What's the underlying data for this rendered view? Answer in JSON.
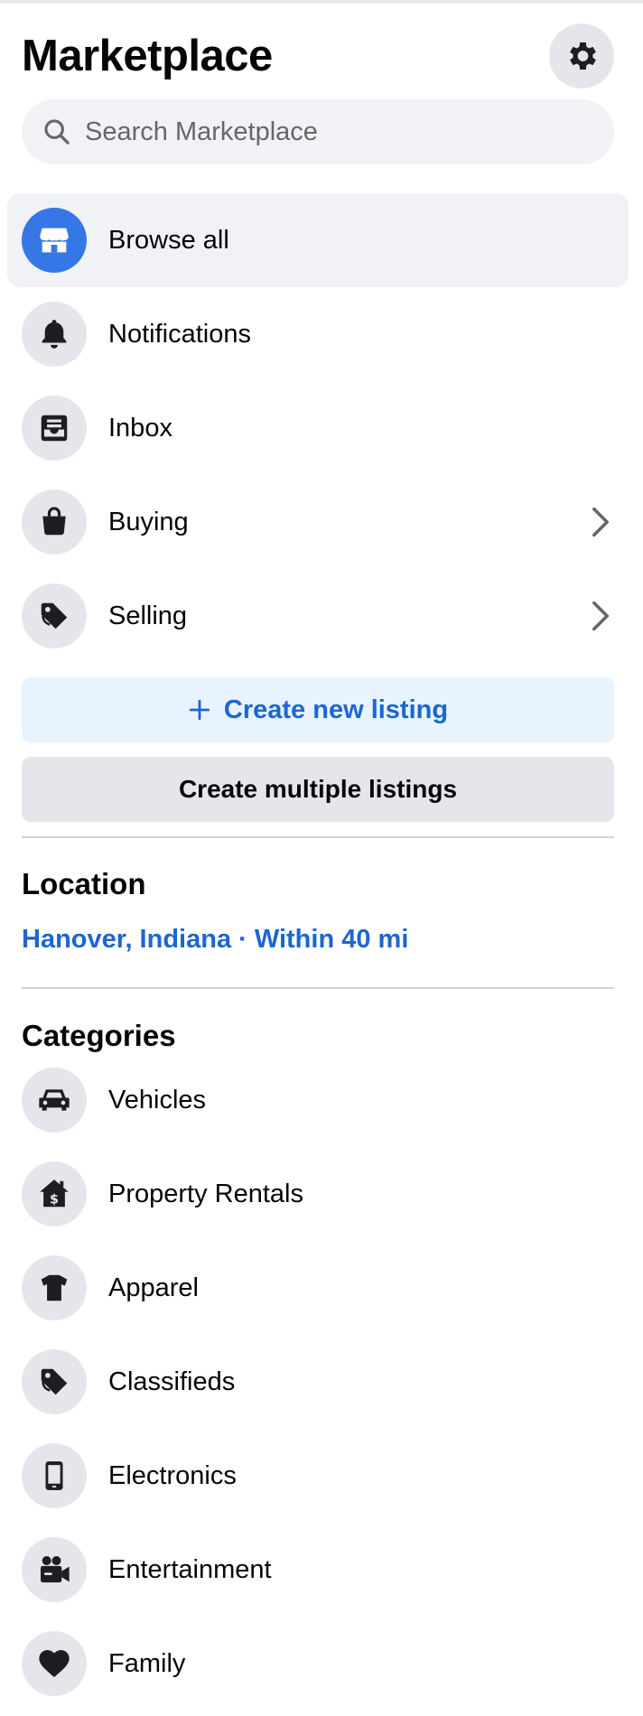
{
  "header": {
    "title": "Marketplace",
    "settings_icon": "gear-icon"
  },
  "search": {
    "placeholder": "Search Marketplace",
    "value": ""
  },
  "nav": {
    "items": [
      {
        "label": "Browse all",
        "icon": "storefront-icon",
        "active": true
      },
      {
        "label": "Notifications",
        "icon": "bell-icon"
      },
      {
        "label": "Inbox",
        "icon": "inbox-icon"
      },
      {
        "label": "Buying",
        "icon": "shopping-bag-icon",
        "has_chevron": true
      },
      {
        "label": "Selling",
        "icon": "price-tag-icon",
        "has_chevron": true
      }
    ]
  },
  "actions": {
    "create_new_listing": "Create new listing",
    "create_multiple_listings": "Create multiple listings"
  },
  "location": {
    "title": "Location",
    "value": "Hanover, Indiana · Within 40 mi"
  },
  "categories": {
    "title": "Categories",
    "items": [
      {
        "label": "Vehicles",
        "icon": "car-icon"
      },
      {
        "label": "Property Rentals",
        "icon": "house-dollar-icon"
      },
      {
        "label": "Apparel",
        "icon": "tshirt-icon"
      },
      {
        "label": "Classifieds",
        "icon": "price-tag-icon"
      },
      {
        "label": "Electronics",
        "icon": "phone-icon"
      },
      {
        "label": "Entertainment",
        "icon": "video-camera-icon"
      },
      {
        "label": "Family",
        "icon": "heart-icon"
      }
    ]
  },
  "colors": {
    "accent": "#1b66d2",
    "accent_bg": "#e7f3ff",
    "active_icon_bg": "#3578e5",
    "icon_circle_bg": "#e4e6eb",
    "active_row_bg": "#f0f2f5"
  }
}
